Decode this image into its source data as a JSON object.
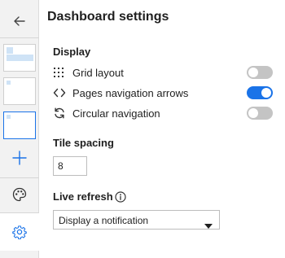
{
  "panel": {
    "title": "Dashboard settings",
    "display": {
      "heading": "Display",
      "options": [
        {
          "label": "Grid layout",
          "icon": "grid-dots-icon",
          "enabled": false
        },
        {
          "label": "Pages navigation arrows",
          "icon": "code-arrows-icon",
          "enabled": true
        },
        {
          "label": "Circular navigation",
          "icon": "circular-arrows-icon",
          "enabled": false
        }
      ]
    },
    "tile_spacing": {
      "heading": "Tile spacing",
      "value": "8"
    },
    "live_refresh": {
      "heading": "Live refresh",
      "selected": "Display a notification"
    }
  },
  "rail": {
    "icons": [
      "back-arrow-icon",
      "plus-icon",
      "palette-icon",
      "gear-icon"
    ],
    "accent_color": "#1a73e8"
  },
  "colors": {
    "toggle_on": "#1a73e8",
    "toggle_off": "#c4c4c4",
    "thumb_fill": "#cfe3f6"
  }
}
